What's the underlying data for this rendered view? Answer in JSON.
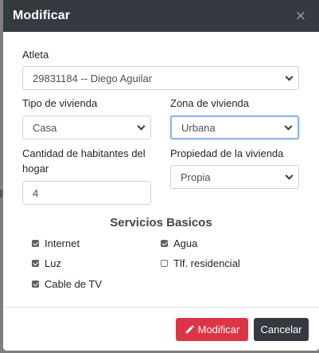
{
  "modal": {
    "title": "Modificar",
    "close_symbol": "×"
  },
  "form": {
    "atleta": {
      "label": "Atleta",
      "value": "29831184 -- Diego Aguilar"
    },
    "tipo_vivienda": {
      "label": "Tipo de vivienda",
      "value": "Casa"
    },
    "zona_vivienda": {
      "label": "Zona de vivienda",
      "value": "Urbana"
    },
    "habitantes": {
      "label": "Cantidad de habitantes del hogar",
      "value": "4"
    },
    "propiedad": {
      "label": "Propiedad de la vivienda",
      "value": "Propia"
    }
  },
  "services": {
    "title": "Servicios Basicos",
    "items": [
      {
        "label": "Internet",
        "checked": true
      },
      {
        "label": "Agua",
        "checked": true
      },
      {
        "label": "Luz",
        "checked": true
      },
      {
        "label": "Tlf. residencial",
        "checked": false
      },
      {
        "label": "Cable de TV",
        "checked": true
      }
    ]
  },
  "footer": {
    "submit_label": "Modificar",
    "cancel_label": "Cancelar"
  },
  "colors": {
    "header_bg": "#343a40",
    "danger": "#dc3545",
    "dark": "#343a40"
  },
  "icons": {
    "close": "close-icon",
    "submit": "pencil-icon",
    "dropdown": "chevron-down-icon"
  }
}
